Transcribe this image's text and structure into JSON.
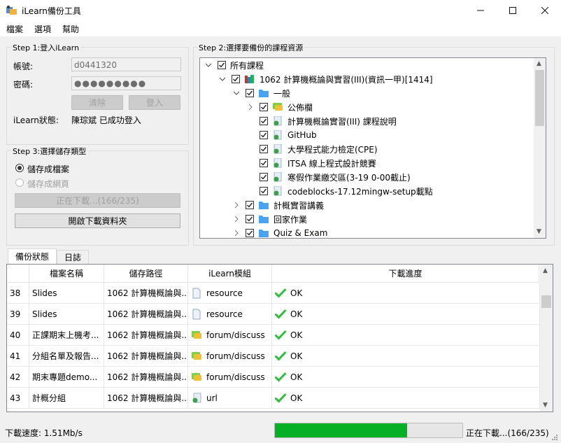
{
  "window": {
    "title": "iLearn備份工具",
    "minimize_icon": "minimize-icon",
    "maximize_icon": "maximize-icon",
    "close_icon": "close-icon"
  },
  "menu": {
    "items": [
      "檔案",
      "選項",
      "幫助"
    ]
  },
  "step1": {
    "title": "Step 1:登入iLearn",
    "account_label": "帳號:",
    "account_value": "d0441320",
    "password_label": "密碼:",
    "password_mask": "●●●●●●●●●",
    "clear_label": "清除",
    "login_label": "登入",
    "status_label": "iLearn狀態:",
    "status_value": "陳琮斌 已成功登入"
  },
  "step3": {
    "title": "Step 3:選擇儲存類型",
    "option_file": "儲存成檔案",
    "option_web": "儲存成網頁",
    "downloading_label": "正在下載...(166/235)",
    "open_folder_label": "開啟下載資料夾"
  },
  "step2": {
    "title": "Step 2:選擇要備份的課程資源",
    "tree": [
      {
        "label": "所有課程",
        "level": 0,
        "expander": "down",
        "icon": "none"
      },
      {
        "label": "1062 計算機概論與實習(III)(資訊一甲)[1414]",
        "level": 1,
        "expander": "down",
        "icon": "books-icon"
      },
      {
        "label": "一般",
        "level": 2,
        "expander": "down",
        "icon": "folder-icon"
      },
      {
        "label": "公佈欄",
        "level": 3,
        "expander": "right",
        "icon": "forum-icon"
      },
      {
        "label": "計算機概論實習(III) 課程說明",
        "level": 3,
        "expander": "none",
        "icon": "url-icon"
      },
      {
        "label": "GitHub",
        "level": 3,
        "expander": "none",
        "icon": "url-icon"
      },
      {
        "label": "大學程式能力檢定(CPE)",
        "level": 3,
        "expander": "none",
        "icon": "url-icon"
      },
      {
        "label": "ITSA 線上程式設計競賽",
        "level": 3,
        "expander": "none",
        "icon": "url-icon"
      },
      {
        "label": "寒假作業繳交區(3-19 0-00截止)",
        "level": 3,
        "expander": "none",
        "icon": "url-icon"
      },
      {
        "label": "codeblocks-17.12mingw-setup載點",
        "level": 3,
        "expander": "none",
        "icon": "url-icon"
      },
      {
        "label": "計概實習講義",
        "level": 2,
        "expander": "right",
        "icon": "folder-icon"
      },
      {
        "label": "回家作業",
        "level": 2,
        "expander": "right",
        "icon": "folder-icon"
      },
      {
        "label": "Quiz & Exam",
        "level": 2,
        "expander": "right",
        "icon": "folder-icon"
      }
    ]
  },
  "tabs": [
    "備份狀態",
    "日誌"
  ],
  "grid": {
    "headers": [
      "檔案名稱",
      "儲存路徑",
      "iLearn模組",
      "下載進度"
    ],
    "rows": [
      {
        "num": "38",
        "name": "Slides",
        "path": "1062 計算機概論與...",
        "module": "resource",
        "module_icon": "file-icon",
        "status": "OK"
      },
      {
        "num": "39",
        "name": "Slides",
        "path": "1062 計算機概論與...",
        "module": "resource",
        "module_icon": "file-icon",
        "status": "OK"
      },
      {
        "num": "40",
        "name": "正課期末上機考...",
        "path": "1062 計算機概論與...",
        "module": "forum/discuss",
        "module_icon": "forum-icon",
        "status": "OK"
      },
      {
        "num": "41",
        "name": "分組名單及報告...",
        "path": "1062 計算機概論與...",
        "module": "forum/discuss",
        "module_icon": "forum-icon",
        "status": "OK"
      },
      {
        "num": "42",
        "name": "期末專題demo...",
        "path": "1062 計算機概論與...",
        "module": "forum/discuss",
        "module_icon": "forum-icon",
        "status": "OK"
      },
      {
        "num": "43",
        "name": "計概分組",
        "path": "1062 計算機概論與...",
        "module": "url",
        "module_icon": "url-icon",
        "status": "OK"
      }
    ]
  },
  "statusbar": {
    "speed": "下載速度: 1.51Mb/s",
    "progress_fraction": 0.7064,
    "progress_text": "正在下載...(166/235)"
  },
  "colors": {
    "progress": "#06b025",
    "ok_check": "#2cbf39",
    "folder": "#4aa3f0"
  }
}
